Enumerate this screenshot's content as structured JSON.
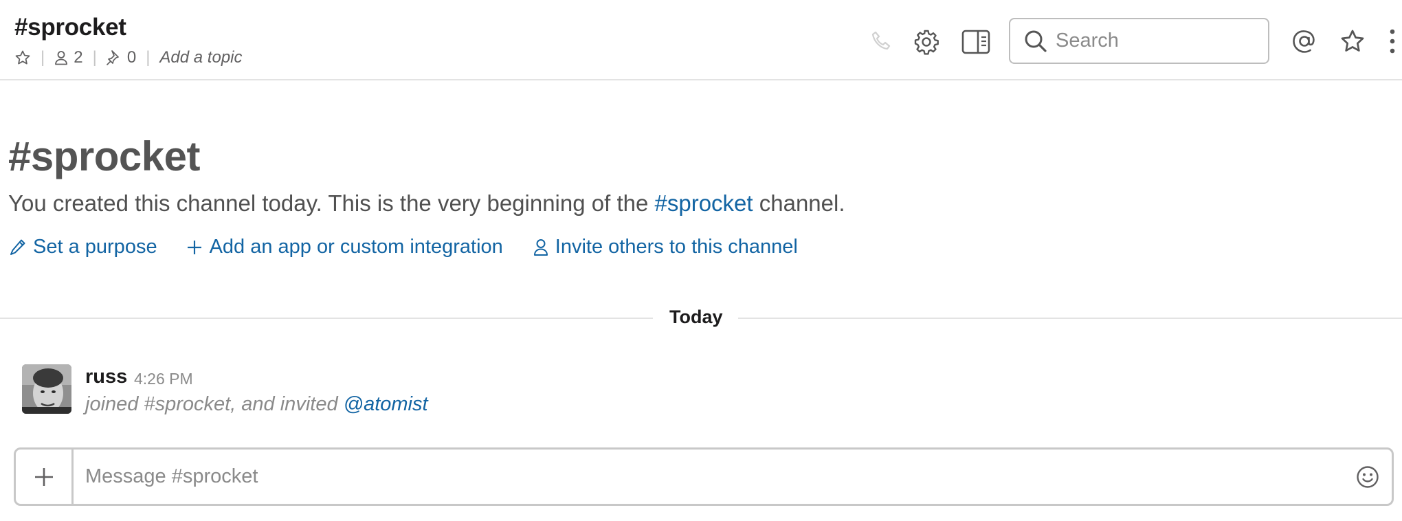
{
  "header": {
    "title": "#sprocket",
    "member_count": "2",
    "pinned_count": "0",
    "topic_placeholder": "Add a topic",
    "search_placeholder": "Search"
  },
  "intro": {
    "title": "#sprocket",
    "text_before": "You created this channel today. This is the very beginning of the ",
    "channel_link": "#sprocket",
    "text_after": " channel.",
    "actions": [
      {
        "label": "Set a purpose",
        "icon": "pencil-icon"
      },
      {
        "label": "Add an app or custom integration",
        "icon": "plus-icon"
      },
      {
        "label": "Invite others to this channel",
        "icon": "person-icon"
      }
    ]
  },
  "divider": {
    "label": "Today"
  },
  "message": {
    "author": "russ",
    "time": "4:26 PM",
    "text": "joined #sprocket, and invited ",
    "mention": "@atomist"
  },
  "composer": {
    "placeholder": "Message #sprocket"
  },
  "colors": {
    "link": "#1264a3",
    "muted": "#8a8a8a",
    "border": "#c8c8c8"
  }
}
